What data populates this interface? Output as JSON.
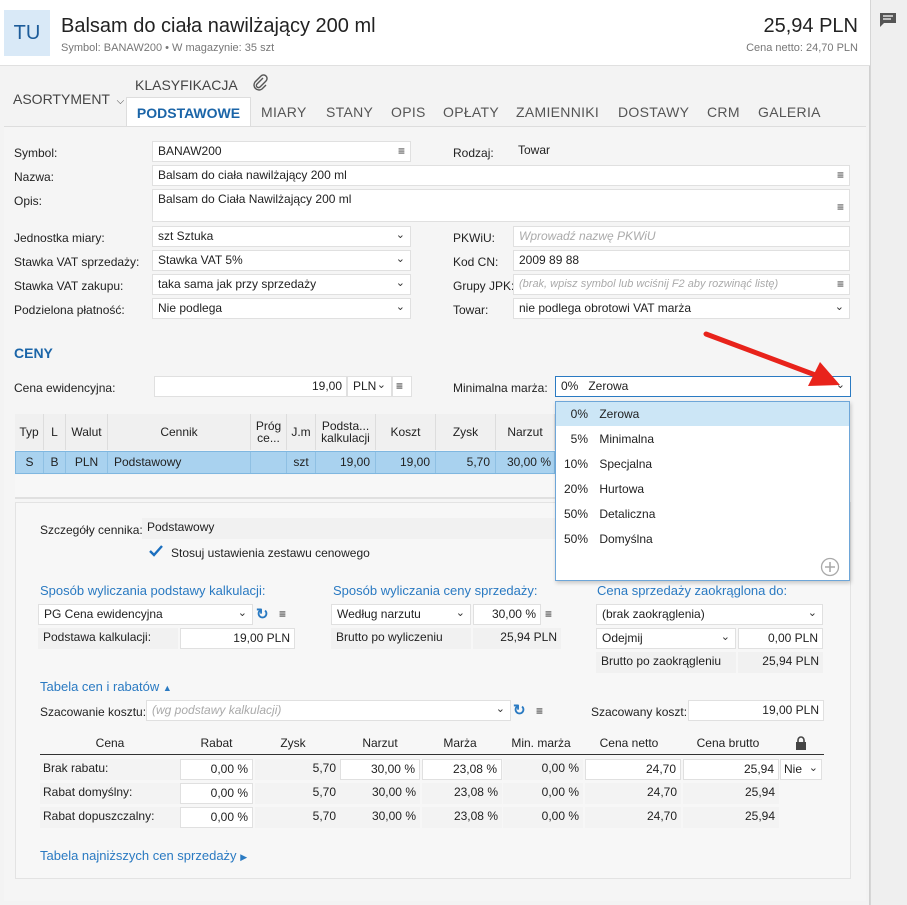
{
  "header": {
    "badge": "TU",
    "title": "Balsam do ciała nawilżający 200 ml",
    "subtitle": "Symbol: BANAW200  •  W magazynie: 35 szt",
    "price": "25,94 PLN",
    "netto": "Cena netto: 24,70 PLN"
  },
  "tabs": {
    "asortyment": "ASORTYMENT",
    "klasyfikacja": "KLASYFIKACJA",
    "items": [
      "PODSTAWOWE",
      "MIARY",
      "STANY",
      "OPIS",
      "OPŁATY",
      "ZAMIENNIKI",
      "DOSTAWY",
      "CRM",
      "GALERIA"
    ]
  },
  "form": {
    "symbol_label": "Symbol:",
    "symbol": "BANAW200",
    "rodzaj_label": "Rodzaj:",
    "rodzaj": "Towar",
    "nazwa_label": "Nazwa:",
    "nazwa": "Balsam do ciała nawilżający 200 ml",
    "opis_label": "Opis:",
    "opis": "Balsam do Ciała Nawilżający 200 ml",
    "jm_label": "Jednostka miary:",
    "jm": "szt  Sztuka",
    "pkwiu_label": "PKWiU:",
    "pkwiu_placeholder": "Wprowadź nazwę PKWiU",
    "vat_sprz_label": "Stawka VAT sprzedaży:",
    "vat_sprz": "Stawka VAT 5%",
    "kodcn_label": "Kod CN:",
    "kodcn": "2009 89 88",
    "vat_zak_label": "Stawka VAT zakupu:",
    "vat_zak": "taka sama jak przy sprzedaży",
    "jpk_label": "Grupy JPK:",
    "jpk_placeholder": "(brak, wpisz symbol lub wciśnij F2 aby rozwinąć listę)",
    "podz_label": "Podzielona płatność:",
    "podz": "Nie podlega",
    "towar_label": "Towar:",
    "towar": "nie podlega obrotowi VAT marża"
  },
  "ceny": {
    "title": "CENY",
    "cena_ew_label": "Cena ewidencyjna:",
    "cena_ew": "19,00",
    "waluta": "PLN",
    "min_marza_label": "Minimalna marża:",
    "min_marza": "0%   Zerowa"
  },
  "dropdown": {
    "items": [
      {
        "pct": "0%",
        "name": "Zerowa"
      },
      {
        "pct": "5%",
        "name": "Minimalna"
      },
      {
        "pct": "10%",
        "name": "Specjalna"
      },
      {
        "pct": "20%",
        "name": "Hurtowa"
      },
      {
        "pct": "50%",
        "name": "Detaliczna"
      },
      {
        "pct": "50%",
        "name": "Domyślna"
      }
    ]
  },
  "grid": {
    "headers": [
      "Typ",
      "L",
      "Walut",
      "Cennik",
      "Próg ce...",
      "J.m",
      "Podsta... kalkulacji",
      "Koszt",
      "Zysk",
      "Narzut"
    ],
    "row": [
      "S",
      "B",
      "PLN",
      "Podstawowy",
      "",
      "szt",
      "19,00",
      "19,00",
      "5,70",
      "30,00 %"
    ]
  },
  "details": {
    "szczegoly_label": "Szczegóły cennika:",
    "szczegoly": "Podstawowy",
    "stosuj": "Stosuj ustawienia zestawu cenowego",
    "sposob_podst": "Sposób wyliczania podstawy kalkulacji:",
    "sposob_ceny": "Sposób wyliczania ceny sprzedaży:",
    "cena_zaokr": "Cena sprzedaży zaokrąglona do:",
    "pg": "PG  Cena ewidencyjna",
    "wedlug": "Według narzutu",
    "narzut_val": "30,00 %",
    "brak_zaokr": "(brak zaokrąglenia)",
    "podst_kalk_label": "Podstawa kalkulacji:",
    "podst_kalk": "19,00 PLN",
    "brutto_wyl_label": "Brutto po wyliczeniu",
    "brutto_wyl": "25,94 PLN",
    "odejmij": "Odejmij",
    "odejmij_val": "0,00 PLN",
    "brutto_zaokr_label": "Brutto po zaokrągleniu",
    "brutto_zaokr": "25,94 PLN",
    "tabela_cen": "Tabela cen i rabatów",
    "szac_kosztu_label": "Szacowanie kosztu:",
    "szac_kosztu_placeholder": "(wg podstawy kalkulacji)",
    "szac_koszt_label": "Szacowany koszt:",
    "szac_koszt": "19,00 PLN",
    "tabela_najn": "Tabela najniższych cen sprzedaży"
  },
  "rabaty": {
    "headers": [
      "Cena",
      "Rabat",
      "Zysk",
      "Narzut",
      "Marża",
      "Min. marża",
      "Cena netto",
      "Cena brutto"
    ],
    "rows": [
      {
        "name": "Brak rabatu:",
        "vals": [
          "0,00 %",
          "5,70",
          "30,00 %",
          "23,08 %",
          "0,00 %",
          "24,70",
          "25,94"
        ],
        "extra": "Nie"
      },
      {
        "name": "Rabat domyślny:",
        "vals": [
          "0,00 %",
          "5,70",
          "30,00 %",
          "23,08 %",
          "0,00 %",
          "24,70",
          "25,94"
        ],
        "extra": ""
      },
      {
        "name": "Rabat dopuszczalny:",
        "vals": [
          "0,00 %",
          "5,70",
          "30,00 %",
          "23,08 %",
          "0,00 %",
          "24,70",
          "25,94"
        ],
        "extra": ""
      }
    ]
  }
}
